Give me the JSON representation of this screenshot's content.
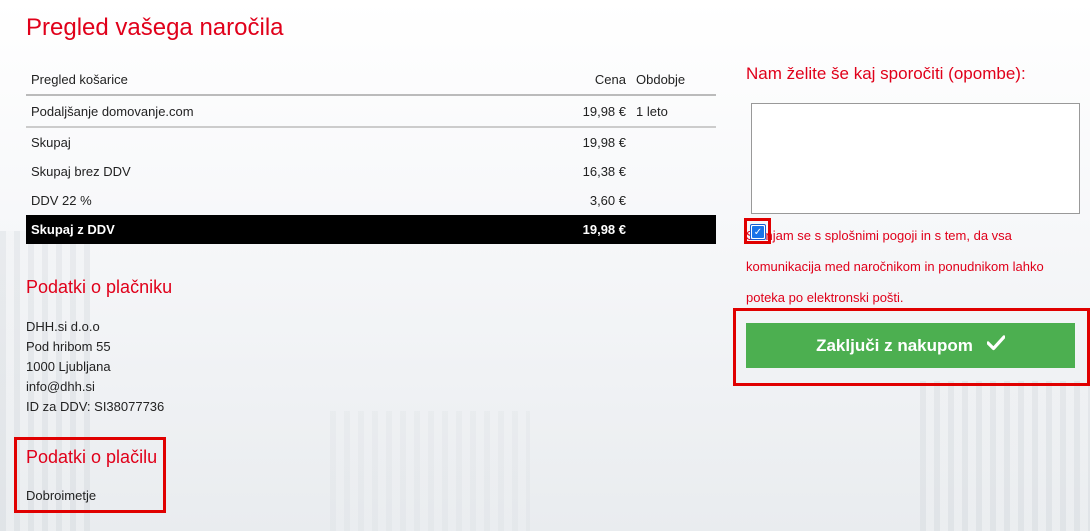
{
  "page": {
    "title": "Pregled vašega naročila"
  },
  "cart": {
    "headers": {
      "item": "Pregled košarice",
      "price": "Cena",
      "period": "Obdobje"
    },
    "items": [
      {
        "name": "Podaljšanje domovanje.com",
        "price": "19,98 €",
        "period": "1 leto"
      }
    ],
    "summary": [
      {
        "label": "Skupaj",
        "value": "19,98 €"
      },
      {
        "label": "Skupaj brez DDV",
        "value": "16,38 €"
      },
      {
        "label": "DDV 22 %",
        "value": "3,60 €"
      }
    ],
    "total": {
      "label": "Skupaj z DDV",
      "value": "19,98 €"
    }
  },
  "payer": {
    "heading": "Podatki o plačniku",
    "lines": [
      "DHH.si d.o.o",
      "Pod hribom 55",
      "1000 Ljubljana",
      "info@dhh.si",
      "ID za DDV: SI38077736"
    ]
  },
  "payment": {
    "heading": "Podatki o plačilu",
    "method": "Dobroimetje"
  },
  "notes": {
    "label": "Nam želite še kaj sporočiti (opombe):",
    "value": ""
  },
  "terms": {
    "checked": true,
    "text": "Strinjam se s splošnimi pogoji in s tem, da vsa komunikacija med naročnikom in ponudnikom lahko poteka po elektronski pošti."
  },
  "actions": {
    "finish_label": "Zaključi z nakupom"
  },
  "colors": {
    "accent": "#e0001a",
    "button": "#4caf50",
    "highlight": "#e00000"
  }
}
